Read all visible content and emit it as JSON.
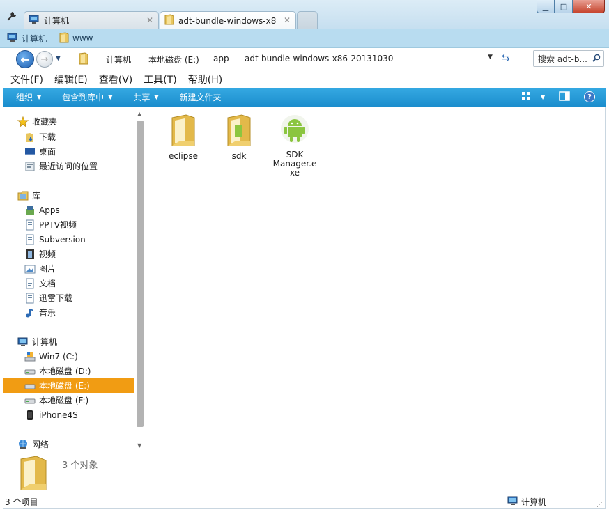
{
  "tabs": [
    {
      "label": "计算机",
      "icon": "computer-icon"
    },
    {
      "label": "adt-bundle-windows-x86-2",
      "icon": "folder-icon"
    }
  ],
  "window_controls": {
    "minimize": "▁",
    "maximize": "□",
    "close": "✕"
  },
  "favorites": [
    {
      "label": "计算机",
      "icon": "computer-icon"
    },
    {
      "label": "www",
      "icon": "folder-icon"
    }
  ],
  "address": {
    "crumbs": [
      "计算机",
      "本地磁盘 (E:)",
      "app",
      "adt-bundle-windows-x86-20131030"
    ],
    "search_text": "搜索 adt-b..."
  },
  "menu": [
    "文件(F)",
    "编辑(E)",
    "查看(V)",
    "工具(T)",
    "帮助(H)"
  ],
  "commands": {
    "organize": "组织",
    "include_library": "包含到库中",
    "share": "共享",
    "new_folder": "新建文件夹",
    "help": "?"
  },
  "navigation": {
    "favorites_header": "收藏夹",
    "favorites": [
      "下载",
      "桌面",
      "最近访问的位置"
    ],
    "libraries_header": "库",
    "libraries": [
      "Apps",
      "PPTV视频",
      "Subversion",
      "视频",
      "图片",
      "文档",
      "迅雷下载",
      "音乐"
    ],
    "computer_header": "计算机",
    "drives": [
      "Win7 (C:)",
      "本地磁盘 (D:)",
      "本地磁盘 (E:)",
      "本地磁盘 (F:)",
      "iPhone4S"
    ],
    "network_header": "网络",
    "selected": "本地磁盘 (E:)"
  },
  "files": [
    {
      "name": "eclipse",
      "type": "folder"
    },
    {
      "name": "sdk",
      "type": "folder"
    },
    {
      "name": "SDK Manager.exe",
      "type": "android-app"
    }
  ],
  "details": {
    "count": "3 个对象"
  },
  "status": {
    "count": "3 个项目",
    "location": "计算机"
  },
  "colors": {
    "accent_bar": "#1b8dcd",
    "selection": "#f19c13",
    "favorites_bar": "#b8dcf0"
  }
}
